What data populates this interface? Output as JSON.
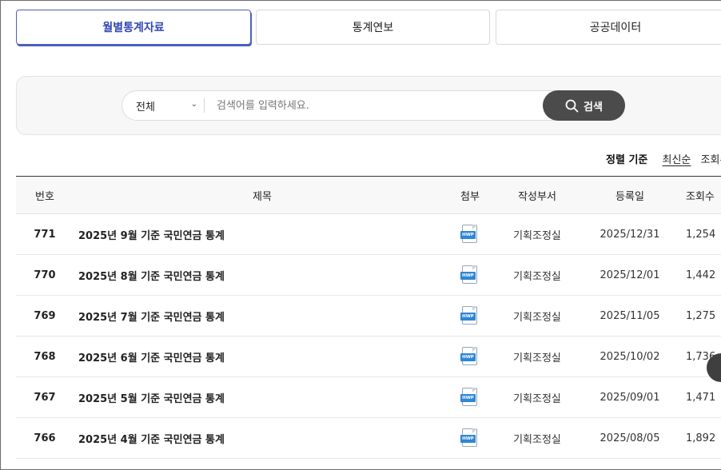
{
  "tabs": [
    "월별통계자료",
    "통계연보",
    "공공데이터"
  ],
  "search": {
    "scope_value": "전체",
    "placeholder": "검색어를 입력하세요.",
    "button_label": "검색"
  },
  "sort": {
    "label": "정렬 기준",
    "options": [
      "최신순",
      "조회수"
    ]
  },
  "table": {
    "headers": [
      "번호",
      "제목",
      "첨부",
      "작성부서",
      "등록일",
      "조회수"
    ],
    "rows": [
      {
        "no": "771",
        "title": "2025년 9월 기준 국민연금 통계",
        "attachment": "HWP",
        "dept": "기획조정실",
        "date": "2025/12/31",
        "views": "1,254"
      },
      {
        "no": "770",
        "title": "2025년 8월 기준 국민연금 통계",
        "attachment": "HWP",
        "dept": "기획조정실",
        "date": "2025/12/01",
        "views": "1,442"
      },
      {
        "no": "769",
        "title": "2025년 7월 기준 국민연금 통계",
        "attachment": "HWP",
        "dept": "기획조정실",
        "date": "2025/11/05",
        "views": "1,275"
      },
      {
        "no": "768",
        "title": "2025년 6월 기준 국민연금 통계",
        "attachment": "HWP",
        "dept": "기획조정실",
        "date": "2025/10/02",
        "views": "1,736"
      },
      {
        "no": "767",
        "title": "2025년 5월 기준 국민연금 통계",
        "attachment": "HWP",
        "dept": "기획조정실",
        "date": "2025/09/01",
        "views": "1,471"
      },
      {
        "no": "766",
        "title": "2025년 4월 기준 국민연금 통계",
        "attachment": "HWP",
        "dept": "기획조정실",
        "date": "2025/08/05",
        "views": "1,892"
      }
    ]
  },
  "colors": {
    "active_tab": "#3347b0",
    "search_button": "#4b4b4b",
    "hwp_icon": "#2f86d6"
  },
  "icons": {
    "search": "search-icon",
    "dropdown": "chevron-down-icon",
    "attachment": "hwp-file-icon"
  }
}
